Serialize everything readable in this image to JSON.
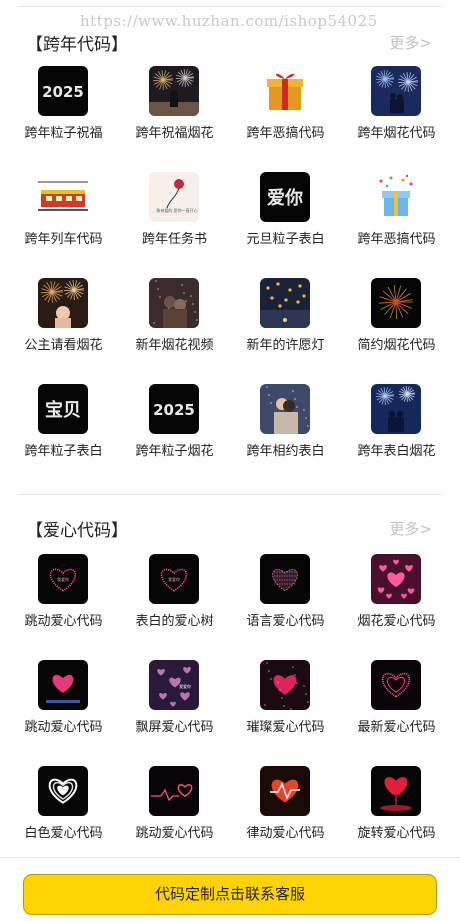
{
  "watermark": "https://www.huzhan.com/ishop54025",
  "sections": [
    {
      "title": "【跨年代码】",
      "more": "更多>",
      "items": [
        {
          "label": "跨年粒子祝福",
          "icon": "text-2025-thumb",
          "thumb_text": "2025"
        },
        {
          "label": "跨年祝福烟花",
          "icon": "fireworks-person-thumb"
        },
        {
          "label": "跨年恶搞代码",
          "icon": "gift-box-thumb"
        },
        {
          "label": "跨年烟花代码",
          "icon": "couple-fireworks-thumb"
        },
        {
          "label": "跨年列车代码",
          "icon": "train-thumb"
        },
        {
          "label": "跨年任务书",
          "icon": "rose-letter-thumb",
          "thumb_text": "致亲爱的 愿你一直开心"
        },
        {
          "label": "元旦粒子表白",
          "icon": "text-love-you-thumb",
          "thumb_text": "爱你"
        },
        {
          "label": "跨年恶搞代码",
          "icon": "gift-confetti-thumb"
        },
        {
          "label": "公主请看烟花",
          "icon": "princess-fireworks-thumb"
        },
        {
          "label": "新年烟花视频",
          "icon": "couple-photo-thumb"
        },
        {
          "label": "新年的许愿灯",
          "icon": "lanterns-thumb"
        },
        {
          "label": "简约烟花代码",
          "icon": "simple-fireworks-thumb"
        },
        {
          "label": "跨年粒子表白",
          "icon": "text-baobei-thumb",
          "thumb_text": "宝贝"
        },
        {
          "label": "跨年粒子烟花",
          "icon": "text-2025-thumb",
          "thumb_text": "2025"
        },
        {
          "label": "跨年相约表白",
          "icon": "couple-hug-thumb"
        },
        {
          "label": "跨年表白烟花",
          "icon": "couple-night-thumb"
        }
      ]
    },
    {
      "title": "【爱心代码】",
      "more": "更多>",
      "items": [
        {
          "label": "跳动爱心代码",
          "icon": "heart-outline-thumb",
          "thumb_text": "我爱你"
        },
        {
          "label": "表白的爱心树",
          "icon": "heart-outline-thumb",
          "thumb_text": "我爱你"
        },
        {
          "label": "语言爱心代码",
          "icon": "heart-text-thumb"
        },
        {
          "label": "烟花爱心代码",
          "icon": "heart-many-thumb"
        },
        {
          "label": "跳动爱心代码",
          "icon": "heart-glow-thumb"
        },
        {
          "label": "飘屏爱心代码",
          "icon": "heart-float-thumb",
          "thumb_text": "我爱你"
        },
        {
          "label": "璀璨爱心代码",
          "icon": "heart-sparkle-thumb"
        },
        {
          "label": "最新爱心代码",
          "icon": "heart-pink-thumb"
        },
        {
          "label": "白色爱心代码",
          "icon": "heart-white-thumb"
        },
        {
          "label": "跳动爱心代码",
          "icon": "heart-pulse-thumb"
        },
        {
          "label": "律动爱心代码",
          "icon": "heart-ecg-thumb"
        },
        {
          "label": "旋转爱心代码",
          "icon": "heart-tree-thumb"
        }
      ]
    }
  ],
  "footer": {
    "cta_label": "代码定制点击联系客服"
  }
}
